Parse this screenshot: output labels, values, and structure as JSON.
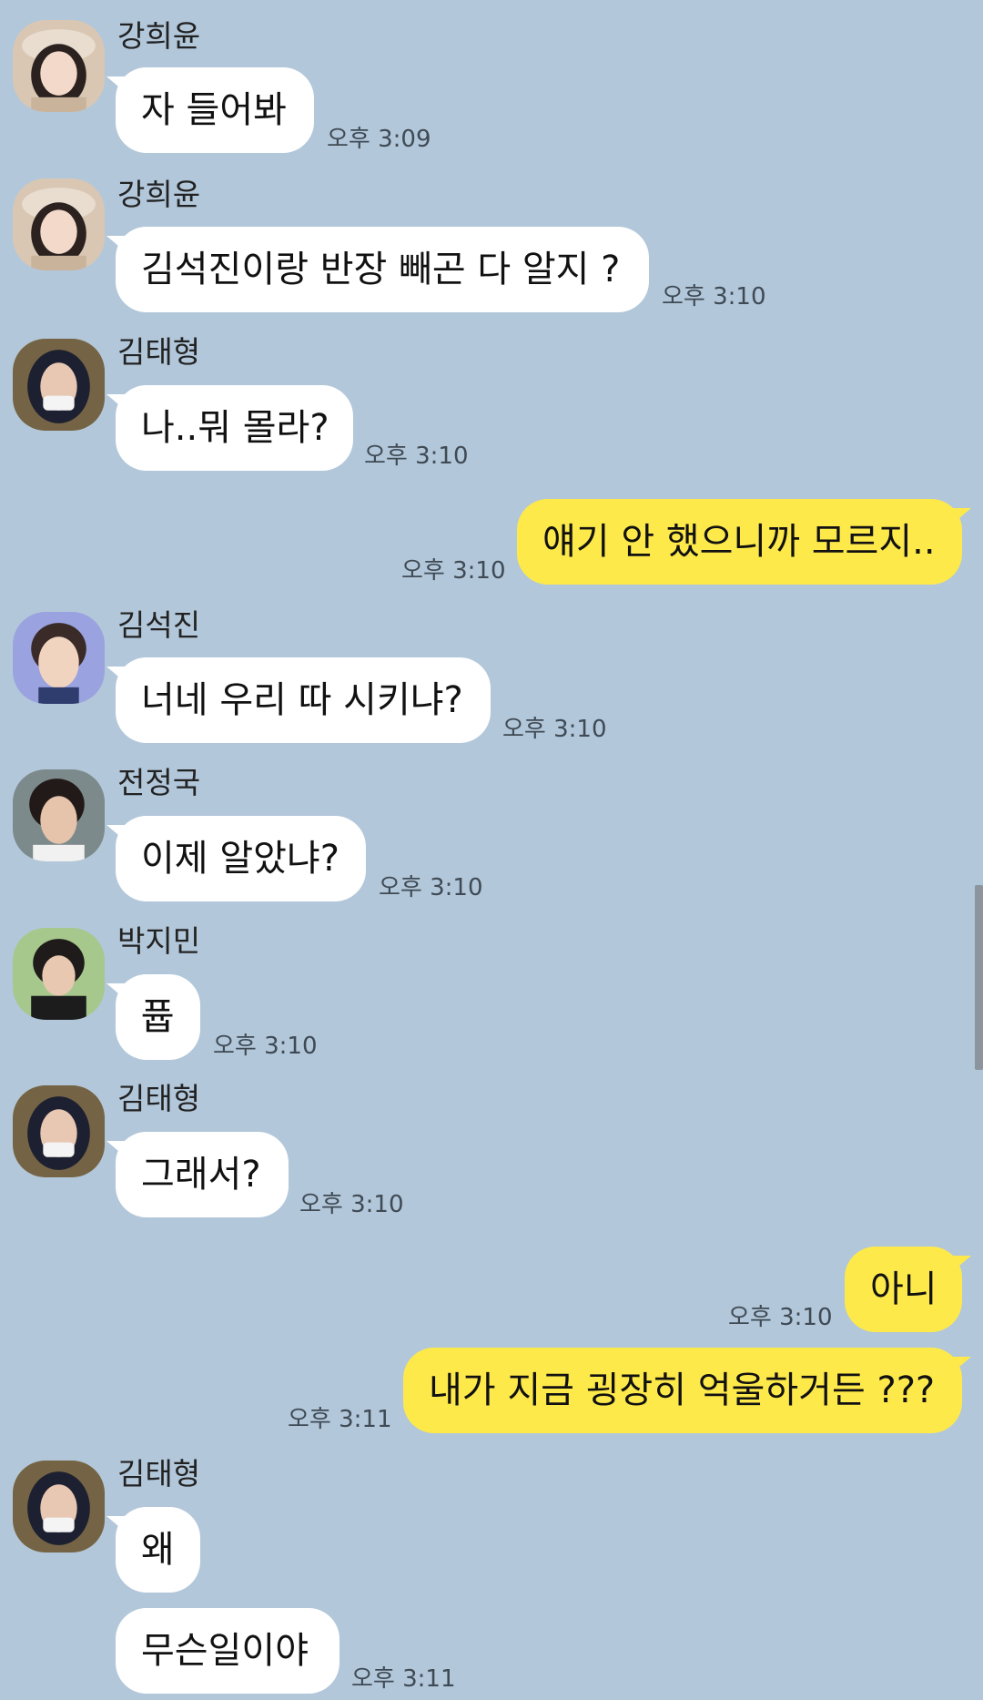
{
  "messages": [
    {
      "sender": "강희윤",
      "text": "자 들어봐",
      "time": "오후 3:09"
    },
    {
      "sender": "강희윤",
      "text": "김석진이랑 반장 빼곤 다 알지 ?",
      "time": "오후 3:10"
    },
    {
      "sender": "김태형",
      "text": "나..뭐 몰라?",
      "time": "오후 3:10"
    },
    {
      "sender": "",
      "text": "얘기 안 했으니까 모르지..",
      "time": "오후 3:10"
    },
    {
      "sender": "김석진",
      "text": "너네 우리 따 시키냐?",
      "time": "오후 3:10"
    },
    {
      "sender": "전정국",
      "text": "이제 알았냐?",
      "time": "오후 3:10"
    },
    {
      "sender": "박지민",
      "text": "퓹",
      "time": "오후 3:10"
    },
    {
      "sender": "김태형",
      "text": "그래서?",
      "time": "오후 3:10"
    },
    {
      "sender": "",
      "text": "아니",
      "time": "오후 3:10"
    },
    {
      "sender": "",
      "text": "내가 지금 굉장히 억울하거든 ???",
      "time": "오후 3:11"
    },
    {
      "sender": "김태형",
      "text": "왜",
      "time": ""
    },
    {
      "sender": "",
      "text": "무슨일이야",
      "time": "오후 3:11"
    }
  ],
  "colors": {
    "background": "#b2c7da",
    "incoming_bubble": "#ffffff",
    "outgoing_bubble": "#fee94b"
  },
  "icons": {
    "avatar": "profile-photo"
  }
}
